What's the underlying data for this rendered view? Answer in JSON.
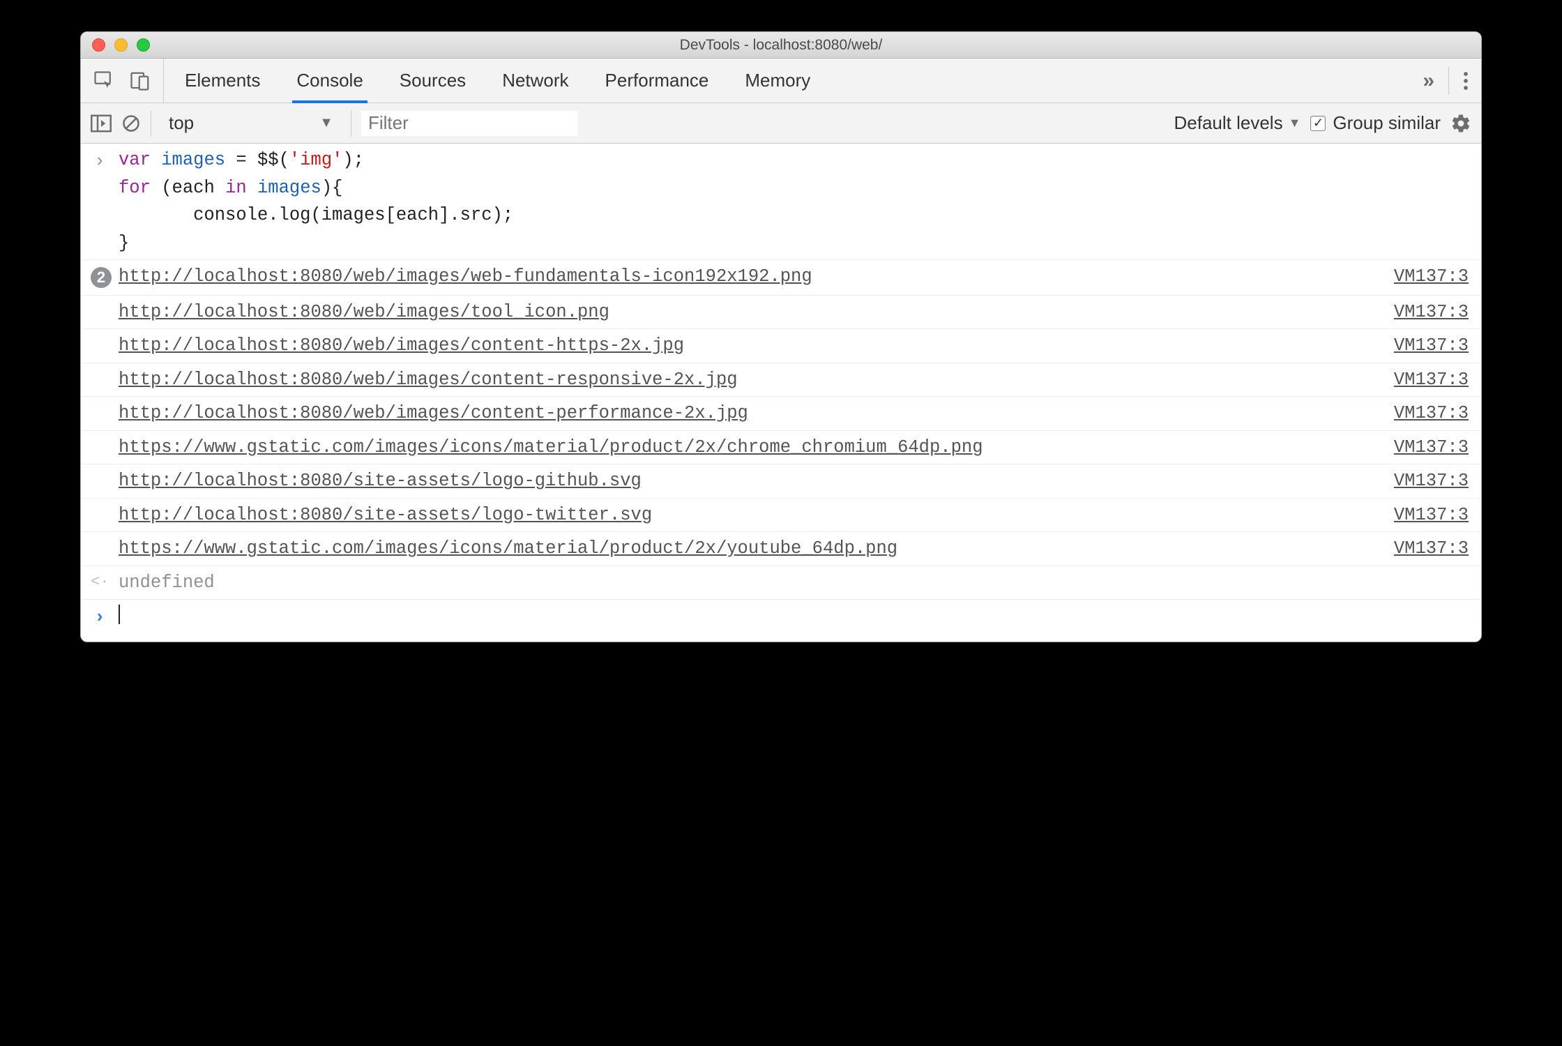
{
  "window": {
    "title": "DevTools - localhost:8080/web/"
  },
  "tabs": [
    "Elements",
    "Console",
    "Sources",
    "Network",
    "Performance",
    "Memory"
  ],
  "active_tab": "Console",
  "filterbar": {
    "context": "top",
    "filter_placeholder": "Filter",
    "levels_label": "Default levels",
    "group_similar_label": "Group similar",
    "group_similar_checked": true
  },
  "code": {
    "line1": {
      "kw": "var",
      "name": "images",
      "eq": " = ",
      "fn": "$$",
      "paren_open": "(",
      "str": "'img'",
      "paren_close": ");"
    },
    "line2": {
      "kw": "for",
      "open": " (",
      "each": "each",
      "in": "in",
      "name": "images",
      "close": "){"
    },
    "line3": {
      "indent": "       ",
      "call": "console.log(images[each].src);"
    },
    "line4": {
      "close": "}"
    }
  },
  "logs": [
    {
      "badge": "2",
      "url": "http://localhost:8080/web/images/web-fundamentals-icon192x192.png",
      "src": "VM137:3"
    },
    {
      "url": "http://localhost:8080/web/images/tool_icon.png",
      "src": "VM137:3"
    },
    {
      "url": "http://localhost:8080/web/images/content-https-2x.jpg",
      "src": "VM137:3"
    },
    {
      "url": "http://localhost:8080/web/images/content-responsive-2x.jpg",
      "src": "VM137:3"
    },
    {
      "url": "http://localhost:8080/web/images/content-performance-2x.jpg",
      "src": "VM137:3"
    },
    {
      "url": "https://www.gstatic.com/images/icons/material/product/2x/chrome_chromium_64dp.png",
      "src": "VM137:3"
    },
    {
      "url": "http://localhost:8080/site-assets/logo-github.svg",
      "src": "VM137:3"
    },
    {
      "url": "http://localhost:8080/site-assets/logo-twitter.svg",
      "src": "VM137:3"
    },
    {
      "url": "https://www.gstatic.com/images/icons/material/product/2x/youtube_64dp.png",
      "src": "VM137:3"
    }
  ],
  "return_value": "undefined"
}
